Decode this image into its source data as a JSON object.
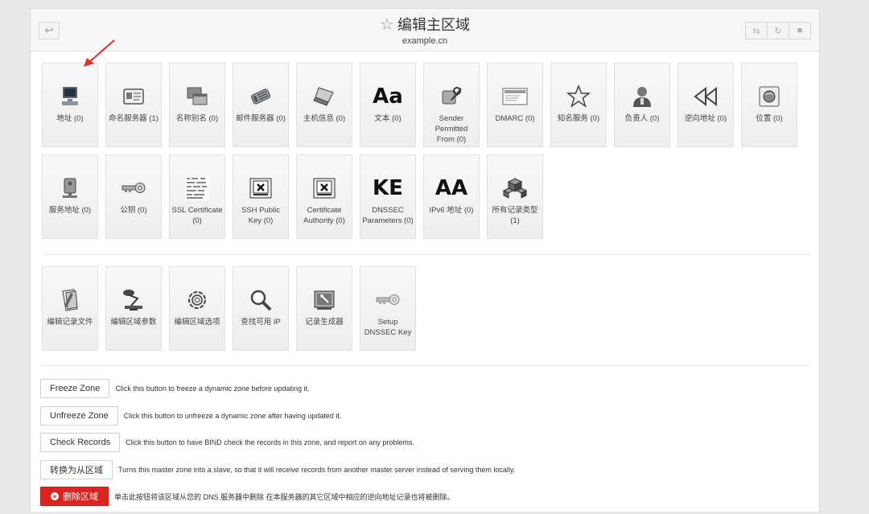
{
  "header": {
    "title": "编辑主区域",
    "subtitle": "example.cn"
  },
  "record_types_row1": [
    {
      "label": "地址 (0)",
      "icon": "computer-icon"
    },
    {
      "label": "命名服务器 (1)",
      "icon": "card-icon"
    },
    {
      "label": "名称别名 (0)",
      "icon": "windows-icon"
    },
    {
      "label": "邮件服务器 (0)",
      "icon": "mail-server-icon"
    },
    {
      "label": "主机信息 (0)",
      "icon": "laptop-icon"
    },
    {
      "label": "文本 (0)",
      "icon": "font-icon",
      "text": "Aa"
    },
    {
      "label": "Sender Permitted From (0)",
      "icon": "wrench-icon"
    },
    {
      "label": "DMARC (0)",
      "icon": "certificate-icon"
    },
    {
      "label": "知名服务 (0)",
      "icon": "star-icon"
    },
    {
      "label": "负责人 (0)",
      "icon": "person-icon"
    },
    {
      "label": "逆向地址 (0)",
      "icon": "rewind-icon"
    },
    {
      "label": "位置 (0)",
      "icon": "globe-icon"
    }
  ],
  "record_types_row2": [
    {
      "label": "服务地址 (0)",
      "icon": "server-icon"
    },
    {
      "label": "公钥 (0)",
      "icon": "key-icon"
    },
    {
      "label": "SSL Certificate (0)",
      "icon": "ssl-cert-icon"
    },
    {
      "label": "SSH Public Key (0)",
      "icon": "ssh-key-icon"
    },
    {
      "label": "Certificate Authority (0)",
      "icon": "ca-icon"
    },
    {
      "label": "DNSSEC Parameters (0)",
      "icon": "dnssec-icon",
      "text": "KE"
    },
    {
      "label": "IPv6 地址 (0)",
      "icon": "ipv6-icon",
      "text": "AA"
    },
    {
      "label": "所有记录类型 (1)",
      "icon": "cubes-icon"
    }
  ],
  "tools": [
    {
      "label": "编辑记录文件",
      "icon": "edit-file-icon"
    },
    {
      "label": "编辑区域参数",
      "icon": "lamp-icon"
    },
    {
      "label": "编辑区域选项",
      "icon": "gear-icon"
    },
    {
      "label": "查找可用 IP",
      "icon": "magnifier-icon"
    },
    {
      "label": "记录生成器",
      "icon": "generator-icon"
    },
    {
      "label": "Setup DNSSEC Key",
      "icon": "dnssec-key-icon"
    }
  ],
  "actions": [
    {
      "button": "Freeze Zone",
      "desc": "Click this button to freeze a dynamic zone before updating it."
    },
    {
      "button": "Unfreeze Zone",
      "desc": "Click this button to unfreeze a dynamic zone after having updated it."
    },
    {
      "button": "Check Records",
      "desc": "Click this button to have BIND check the records in this zone, and report on any problems."
    },
    {
      "button": "转换为从区域",
      "desc": "Turns this master zone into a slave, so that it will receive records from another master server instead of serving them locally."
    },
    {
      "button": "删除区域",
      "desc": "单击此按钮将该区域从您的 DNS 服务器中删除 在本服务器的其它区域中相应的逆向地址记录也将被删除。"
    }
  ],
  "colors": {
    "danger": "#d9241f",
    "arrow": "#e0302a"
  }
}
